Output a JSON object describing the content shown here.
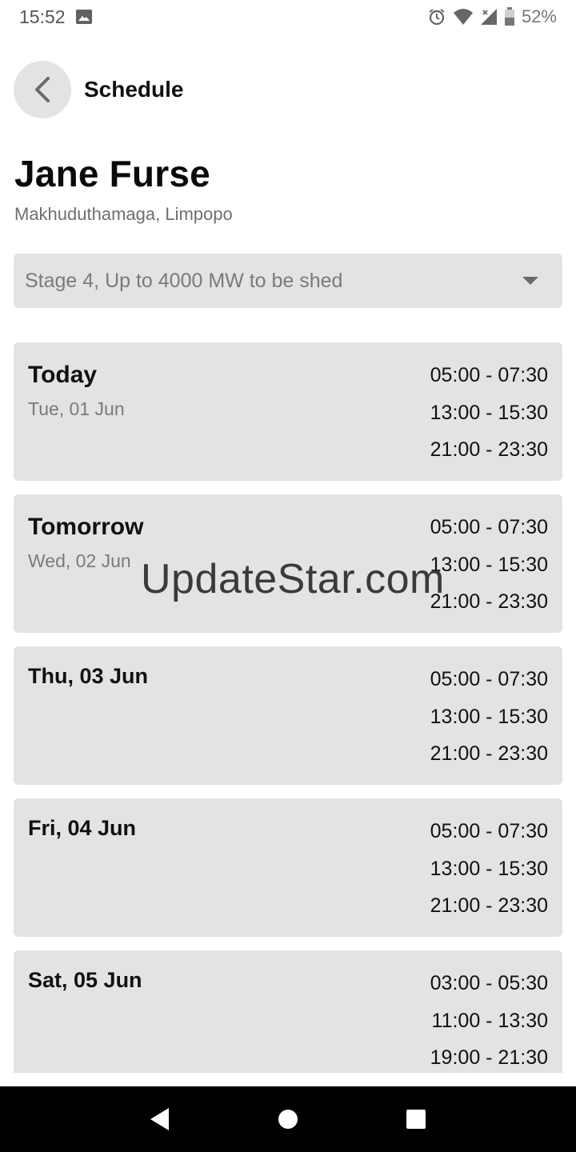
{
  "status_bar": {
    "time": "15:52",
    "battery_percent": "52%",
    "icons": [
      "image-icon",
      "alarm-icon",
      "wifi-icon",
      "signal-icon",
      "battery-icon"
    ]
  },
  "header": {
    "title": "Schedule",
    "back_icon": "chevron-left-icon"
  },
  "location": {
    "name": "Jane Furse",
    "area": "Makhuduthamaga, Limpopo"
  },
  "stage_select": {
    "selected": "Stage 4, Up to 4000 MW to be shed",
    "icon": "dropdown-arrow-icon"
  },
  "days": [
    {
      "title": "Today",
      "date": "Tue, 01 Jun",
      "slots": [
        "05:00 - 07:30",
        "13:00 - 15:30",
        "21:00 - 23:30"
      ]
    },
    {
      "title": "Tomorrow",
      "date": "Wed, 02 Jun",
      "slots": [
        "05:00 - 07:30",
        "13:00 - 15:30",
        "21:00 - 23:30"
      ]
    },
    {
      "title": "Thu, 03 Jun",
      "date": "",
      "slots": [
        "05:00 - 07:30",
        "13:00 - 15:30",
        "21:00 - 23:30"
      ]
    },
    {
      "title": "Fri, 04 Jun",
      "date": "",
      "slots": [
        "05:00 - 07:30",
        "13:00 - 15:30",
        "21:00 - 23:30"
      ]
    },
    {
      "title": "Sat, 05 Jun",
      "date": "",
      "slots": [
        "03:00 - 05:30",
        "11:00 - 13:30",
        "19:00 - 21:30"
      ]
    }
  ],
  "watermark": "UpdateStar.com",
  "nav_bar": {
    "buttons": [
      "back-triangle-icon",
      "home-circle-icon",
      "recents-square-icon"
    ]
  },
  "colors": {
    "card_background": "#e3e3e3",
    "muted_text": "#7a7a7a",
    "nav_bar": "#000000"
  }
}
